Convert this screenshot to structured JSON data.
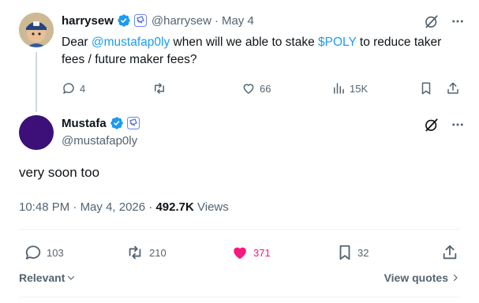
{
  "parent_tweet": {
    "display_name": "harrysew",
    "handle": "@harrysew",
    "date": "May 4",
    "separator": "·",
    "text_before": "Dear ",
    "mention": "@mustafap0ly",
    "text_middle": " when will we able to stake ",
    "cashtag": "$POLY",
    "text_after": " to reduce taker fees / future maker fees?",
    "stats": {
      "replies": "4",
      "likes": "66",
      "views": "15K"
    }
  },
  "main_tweet": {
    "display_name": "Mustafa",
    "handle": "@mustafap0ly",
    "text": "very soon too",
    "time": "10:48 PM",
    "date": "May 4, 2026",
    "dot": "·",
    "views_count": "492.7K",
    "views_label": "Views",
    "stats": {
      "replies": "103",
      "reposts": "210",
      "likes": "371",
      "bookmarks": "32"
    }
  },
  "footer": {
    "sort_label": "Relevant",
    "view_quotes_label": "View quotes"
  },
  "colors": {
    "accent": "#1d9bf0",
    "like_active": "#f91880",
    "muted": "#536471"
  }
}
